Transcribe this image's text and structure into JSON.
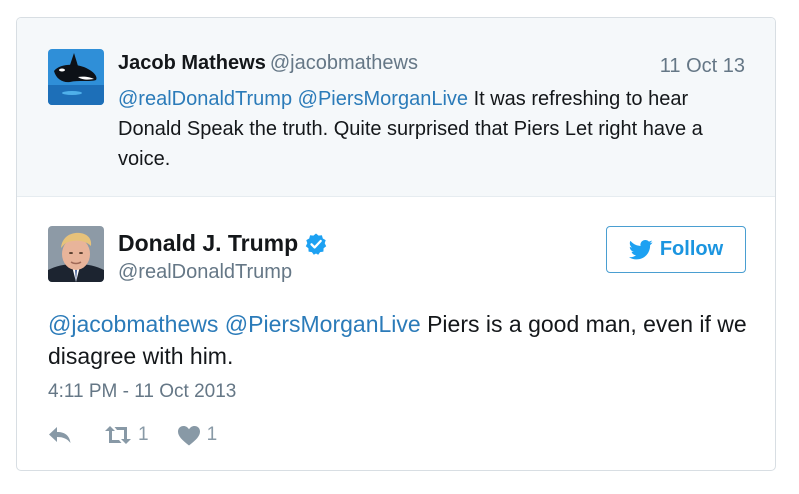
{
  "quoted_tweet": {
    "author_name": "Jacob Mathews",
    "author_handle": "@jacobmathews",
    "date": "11 Oct 13",
    "mention_1": "@realDonaldTrump",
    "mention_2": "@PiersMorganLive",
    "text": " It was refreshing to hear Donald Speak the truth. Quite surprised that Piers Let right have a voice."
  },
  "tweet": {
    "author_name": "Donald J. Trump",
    "author_handle": "@realDonaldTrump",
    "mention_1": "@jacobmathews",
    "mention_2": "@PiersMorganLive",
    "text": " Piers is a good man, even if we disagree with him.",
    "timestamp": "4:11 PM - 11 Oct 2013"
  },
  "follow_button": {
    "label": "Follow"
  },
  "actions": {
    "retweet_count": "1",
    "like_count": "1"
  },
  "colors": {
    "link": "#2b7bb9",
    "muted": "#657786",
    "follow": "#1b95e0",
    "quoted_bg": "#f5f8fa"
  },
  "icons": [
    "orca-avatar",
    "trump-avatar",
    "verified-badge-icon",
    "bird-icon",
    "reply-icon",
    "retweet-icon",
    "heart-icon"
  ]
}
